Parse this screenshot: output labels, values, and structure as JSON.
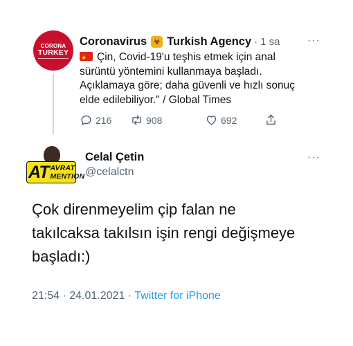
{
  "parent_tweet": {
    "avatar_text_line1": "CORONA",
    "avatar_text_line2": "TURKEY",
    "author_name_part1": "Coronavirus",
    "author_name_part2": "Turkish Agency",
    "separator": "·",
    "time": "1 sa",
    "more_label": "···",
    "text_line1": "Çin, Covid-19'u teşhis etmek için anal",
    "text_line2": "sürüntü yöntemini kullanmaya başladı.",
    "text_line3": "Açıklamaya göre; daha güvenli ve hızlı sonuç",
    "text_line4": "elde edilebiliyor.\" / Global Times",
    "reply_count": "216",
    "retweet_count": "908",
    "like_count": "692"
  },
  "main_tweet": {
    "badge_big": "AT",
    "badge_word1": "AVRAT",
    "badge_word2": "MENTION",
    "author_name": "Celal Çetin",
    "handle": "@celalctn",
    "more_label": "···",
    "text_line1": "Çok direnmeyelim çip falan ne",
    "text_line2": "takılcaksa takılsın işin rengi değişmeye",
    "text_line3": "başladı:)",
    "timestamp": "21:54 · 24.01.2021",
    "timestamp_sep": " · ",
    "source": "Twitter for iPhone"
  },
  "colors": {
    "link_blue": "#1d9bf0",
    "secondary_text": "#536471",
    "primary_text": "#0f1419",
    "avatar_red": "#c8102e",
    "badge_yellow": "#f5e21c"
  }
}
